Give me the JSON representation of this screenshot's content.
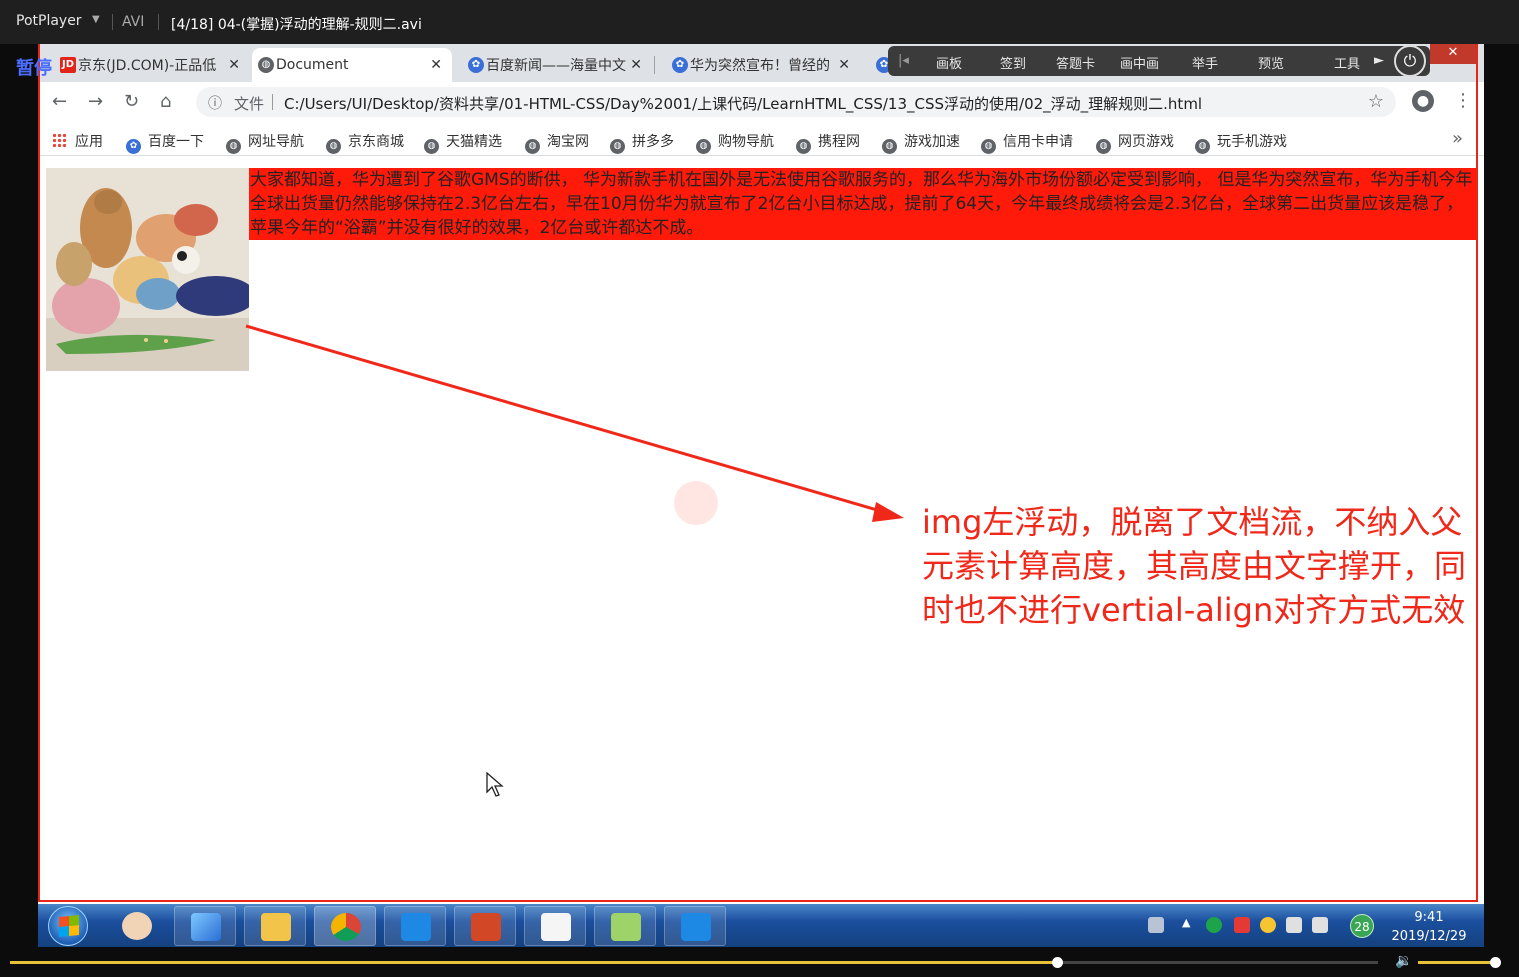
{
  "player": {
    "brand": "PotPlayer",
    "format": "AVI",
    "file_title": "[4/18] 04-(掌握)浮动的理解-规则二.avi",
    "pause_label": "暂停",
    "seek_progress": 0.765,
    "volume_level": 0.98
  },
  "browser": {
    "tabs": [
      {
        "title": "京东(JD.COM)-正品低",
        "icon": "jd-icon",
        "active": false
      },
      {
        "title": "Document",
        "icon": "globe-icon",
        "active": true
      },
      {
        "title": "百度新闻——海量中文",
        "icon": "baidu-paw-icon",
        "active": false
      },
      {
        "title": "华为突然宣布！曾经的",
        "icon": "baidu-paw-icon",
        "active": false
      }
    ],
    "address": {
      "scheme_label": "文件",
      "url": "C:/Users/UI/Desktop/资料共享/01-HTML-CSS/Day%2001/上课代码/LearnHTML_CSS/13_CSS浮动的使用/02_浮动_理解规则二.html"
    },
    "bookmarks": {
      "apps_label": "应用",
      "items": [
        "百度一下",
        "网址导航",
        "京东商城",
        "天猫精选",
        "淘宝网",
        "拼多多",
        "购物导航",
        "携程网",
        "游戏加速",
        "信用卡申请",
        "网页游戏",
        "玩手机游戏"
      ],
      "more": "»"
    }
  },
  "classroom_toolbar": {
    "items": [
      "画板",
      "签到",
      "答题卡",
      "画中画",
      "举手",
      "预览",
      "工具"
    ]
  },
  "page": {
    "paragraph": "大家都知道，华为遭到了谷歌GMS的断供， 华为新款手机在国外是无法使用谷歌服务的，那么华为海外市场份额必定受到影响， 但是华为突然宣布，华为手机今年全球出货量仍然能够保持在2.3亿台左右，早在10月份华为就宣布了2亿台小目标达成，提前了64天，今年最终成绩将会是2.3亿台，全球第二出货量应该是稳了，苹果今年的“浴霸”并没有很好的效果，2亿台或许都达不成。",
    "annotation": "img左浮动，脱离了文档流，不纳入父元素计算高度，其高度由文字撑开，同时也不进行vertial-align对齐方式无效"
  },
  "taskbar": {
    "apps": [
      "avatar-app",
      "kuaibo-player",
      "file-explorer",
      "chrome",
      "vscode",
      "powerpoint",
      "typora",
      "notepad-app",
      "vscode"
    ],
    "tray_badge": "28",
    "time": "9:41",
    "date": "2019/12/29"
  },
  "colors": {
    "highlight_red": "#ff1a0a",
    "annotation_red": "#f0281a",
    "seek_accent": "#e7c13a"
  }
}
